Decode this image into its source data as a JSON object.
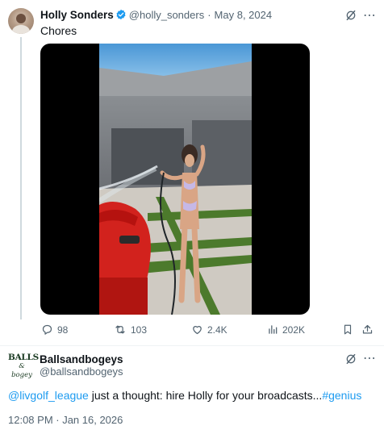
{
  "tweet": {
    "author_name": "Holly Sonders",
    "handle": "@holly_sonders",
    "separator": "·",
    "date": "May 8, 2024",
    "text": "Chores",
    "stats": {
      "replies": "98",
      "reposts": "103",
      "likes": "2.4K",
      "views": "202K"
    }
  },
  "reply": {
    "author_name": "Ballsandbogeys",
    "handle": "@ballsandbogeys",
    "avatar_line1": "BALLS",
    "avatar_line2": "& bogey",
    "mention": "@livgolf_league",
    "body": " just a thought: hire Holly for your broadcasts...",
    "hashtag": "#genius",
    "timestamp": "12:08 PM · Jan 16, 2026"
  },
  "colors": {
    "accent": "#1d9bf0",
    "secondary_text": "#536471",
    "divider": "#eff3f4"
  },
  "icons": [
    "verified-badge-icon",
    "grok-icon",
    "more-icon",
    "reply-icon",
    "repost-icon",
    "like-icon",
    "views-icon",
    "bookmark-icon",
    "share-icon"
  ]
}
